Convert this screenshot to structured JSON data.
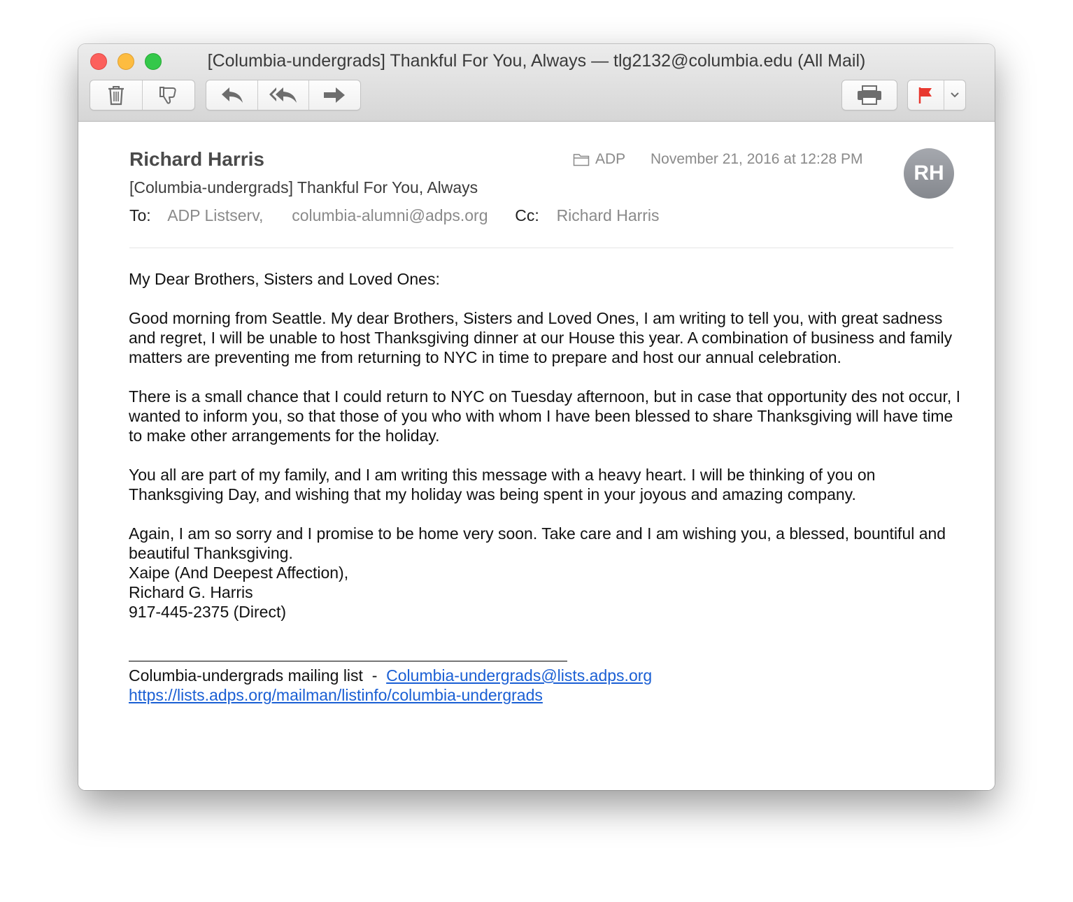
{
  "window": {
    "title": "[Columbia-undergrads] Thankful For You, Always — tlg2132@columbia.edu (All Mail)"
  },
  "toolbar": {
    "icons": [
      "trash-icon",
      "junk-thumbs-down-icon",
      "reply-icon",
      "reply-all-icon",
      "forward-icon",
      "print-icon",
      "flag-icon",
      "chevron-down-icon"
    ],
    "flag_color": "#e8382f"
  },
  "header": {
    "sender": "Richard Harris",
    "subject": "[Columbia-undergrads] Thankful For You, Always",
    "to_label": "To:",
    "to": [
      "ADP Listserv,",
      "columbia-alumni@adps.org"
    ],
    "cc_label": "Cc:",
    "cc": "Richard Harris",
    "mailbox": "ADP",
    "date": "November 21, 2016 at 12:28 PM",
    "avatar_initials": "RH"
  },
  "body": {
    "greeting": "My Dear Brothers, Sisters and Loved Ones:",
    "p1": "Good morning from Seattle. My dear Brothers, Sisters and Loved Ones, I am writing to tell you, with great sadness and regret, I will be unable to host Thanksgiving dinner at our House this year. A combination of business and family matters are preventing me from returning to NYC in time to prepare and host our annual celebration.",
    "p2": "There is a small chance that I could return to NYC on Tuesday afternoon, but in case that opportunity des not occur, I wanted to inform you, so that those of you who with whom I have been blessed to share Thanksgiving will have time to make other arrangements for the holiday.",
    "p3": "You all are part of my family, and I am writing this message with a heavy heart. I will be thinking of you on Thanksgiving Day, and wishing that my holiday was being spent in your joyous and amazing company.",
    "p4": "Again, I am so sorry and I promise to be home very soon. Take care and I am wishing you, a blessed, bountiful and beautiful Thanksgiving.",
    "closing": "Xaipe (And Deepest Affection),",
    "name": "Richard G. Harris",
    "phone": "917-445-2375 (Direct)"
  },
  "footer": {
    "list_label": "Columbia-undergrads mailing list  -  ",
    "list_email": "Columbia-undergrads@lists.adps.org",
    "list_url": "https://lists.adps.org/mailman/listinfo/columbia-undergrads"
  }
}
